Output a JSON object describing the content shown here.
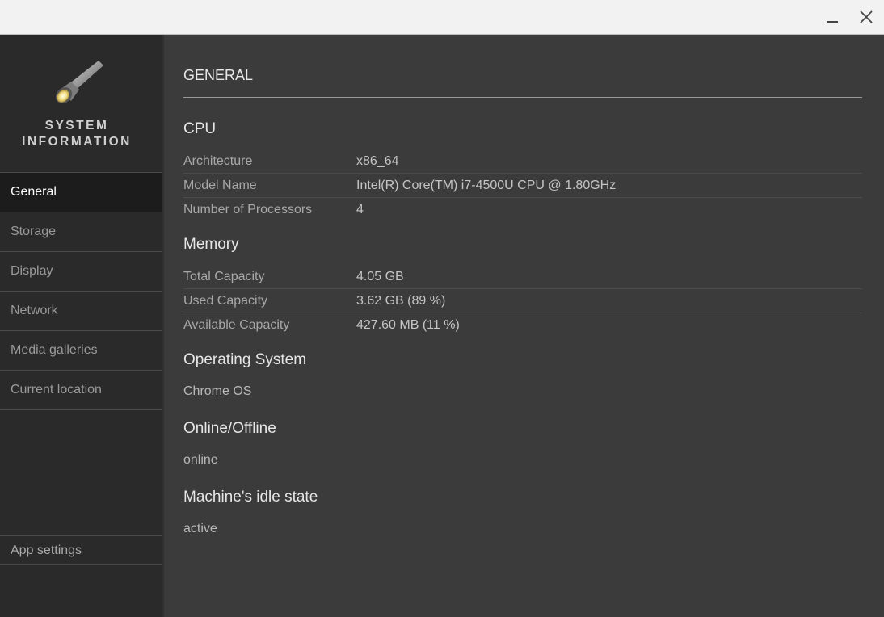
{
  "window": {
    "minimize_icon": "minimize-icon",
    "close_icon": "close-icon"
  },
  "sidebar": {
    "app_name_line1": "SYSTEM",
    "app_name_line2": "INFORMATION",
    "logo_icon": "flashlight-icon",
    "items": [
      {
        "label": "General",
        "active": true
      },
      {
        "label": "Storage",
        "active": false
      },
      {
        "label": "Display",
        "active": false
      },
      {
        "label": "Network",
        "active": false
      },
      {
        "label": "Media galleries",
        "active": false
      },
      {
        "label": "Current location",
        "active": false
      }
    ],
    "settings_label": "App settings"
  },
  "main": {
    "title": "GENERAL",
    "cpu": {
      "heading": "CPU",
      "rows": [
        {
          "key": "Architecture",
          "value": "x86_64"
        },
        {
          "key": "Model Name",
          "value": "Intel(R) Core(TM) i7-4500U CPU @ 1.80GHz"
        },
        {
          "key": "Number of Processors",
          "value": "4"
        }
      ]
    },
    "memory": {
      "heading": "Memory",
      "rows": [
        {
          "key": "Total Capacity",
          "value": "4.05 GB"
        },
        {
          "key": "Used Capacity",
          "value": "3.62 GB (89 %)"
        },
        {
          "key": "Available Capacity",
          "value": "427.60 MB (11 %)"
        }
      ]
    },
    "os": {
      "heading": "Operating System",
      "value": "Chrome OS"
    },
    "online": {
      "heading": "Online/Offline",
      "value": "online"
    },
    "idle": {
      "heading": "Machine's idle state",
      "value": "active"
    }
  },
  "colors": {
    "titlebar_bg": "#f2f2f2",
    "sidebar_bg": "#2a2a2a",
    "sidebar_active_bg": "#1c1c1c",
    "main_bg": "#3b3b3b"
  }
}
